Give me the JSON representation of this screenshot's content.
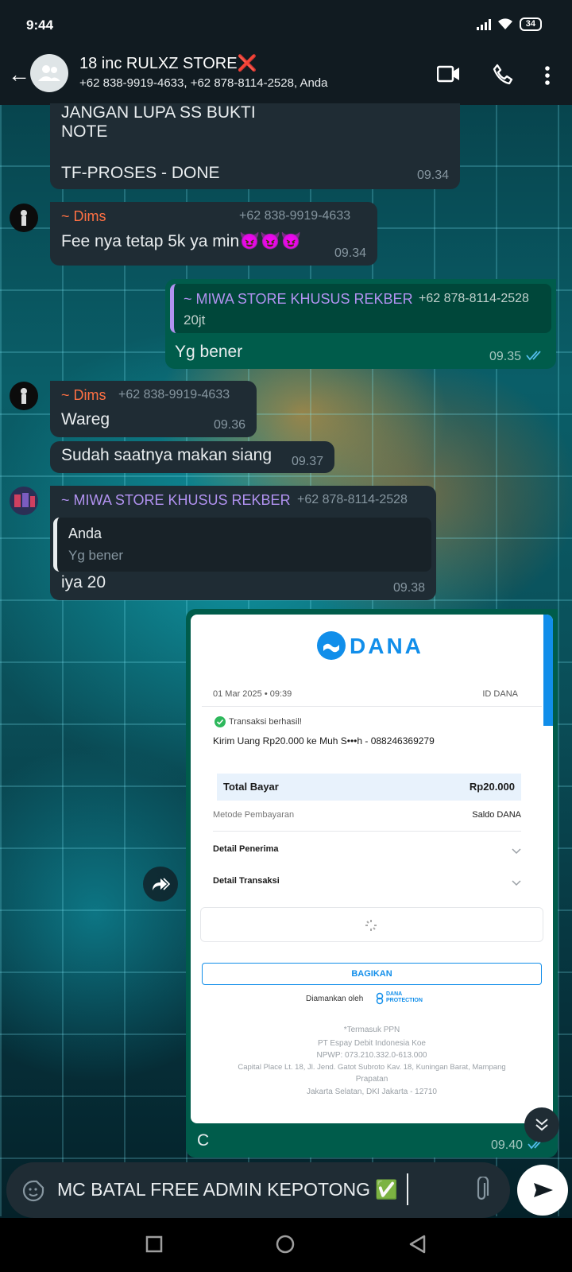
{
  "status": {
    "time": "9:44",
    "battery": "34"
  },
  "header": {
    "title": "18 inc RULXZ STORE❌",
    "subtitle": "+62 838-9919-4633, +62 878-8114-2528, Anda"
  },
  "messages": {
    "m1": {
      "lines": [
        "JANGAN LUPA SS BUKTI",
        "NOTE",
        "",
        "TF-PROSES - DONE"
      ],
      "time": "09.34"
    },
    "m2": {
      "sender": "~ Dims",
      "phone": "+62 838-9919-4633",
      "text": "Fee nya tetap 5k ya min😈😈😈",
      "time": "09.34"
    },
    "m3": {
      "quote_sender": "~ MIWA STORE KHUSUS REKBER",
      "quote_phone": "+62 878-8114-2528",
      "quote_text": "20jt",
      "text": "Yg bener",
      "time": "09.35"
    },
    "m4": {
      "sender": "~ Dims",
      "phone": "+62 838-9919-4633",
      "text": "Wareg",
      "time": "09.36"
    },
    "m5": {
      "text": "Sudah saatnya makan siang",
      "time": "09.37"
    },
    "m6": {
      "sender": "~ MIWA STORE KHUSUS REKBER",
      "phone": "+62 878-8114-2528",
      "quote_sender": "Anda",
      "quote_text": "Yg bener",
      "text": "iya 20",
      "time": "09.38"
    },
    "m7": {
      "caption": "C",
      "time": "09.40"
    }
  },
  "receipt": {
    "logo": "DANA",
    "date": "01 Mar 2025 • 09:39",
    "id_label": "ID DANA",
    "status": "Transaksi berhasil!",
    "description": "Kirim Uang Rp20.000 ke Muh S•••h - 088246369279",
    "total_label": "Total Bayar",
    "total_value": "Rp20.000",
    "method_label": "Metode Pembayaran",
    "method_value": "Saldo DANA",
    "detail_penerima": "Detail Penerima",
    "detail_transaksi": "Detail Transaksi",
    "share": "BAGIKAN",
    "secured_by": "Diamankan oleh",
    "protection_line1": "DANA",
    "protection_line2": "PROTECTION",
    "ppn": "*Termasuk PPN",
    "company": "PT Espay Debit Indonesia Koe",
    "npwp": "NPWP: 073.210.332.0-613.000",
    "address1": "Capital Place Lt. 18, Jl. Jend. Gatot Subroto Kav. 18, Kuningan Barat, Mampang",
    "address2": "Prapatan",
    "address3": "Jakarta Selatan, DKI Jakarta - 12710"
  },
  "composer": {
    "text": "MC BATAL FREE ADMIN KEPOTONG ✅"
  },
  "colors": {
    "incoming_bubble": "#1f2c34",
    "outgoing_bubble": "#005c4b",
    "dims": "#ff7043",
    "miwa": "#b192f0",
    "dana_blue": "#118eea"
  }
}
